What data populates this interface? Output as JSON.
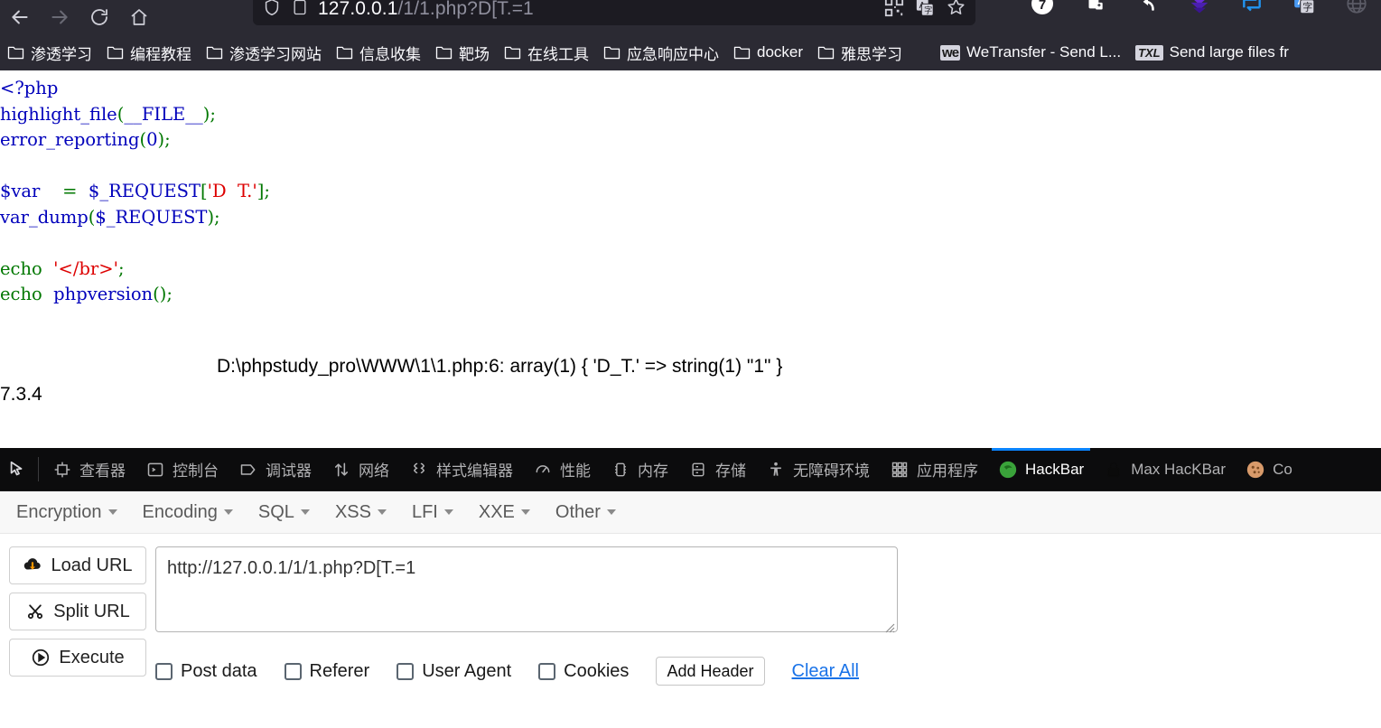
{
  "browser": {
    "nav": {
      "back_icon": "arrow-left-icon",
      "forward_icon": "arrow-right-icon",
      "reload_icon": "reload-icon",
      "home_icon": "home-icon"
    },
    "urlbar": {
      "shield_icon": "shield-icon",
      "page_icon": "page-icon",
      "url_host": "127.0.0.1",
      "url_path": "/1/1.php?D[T.=1",
      "url_full": "127.0.0.1/1/1.php?D[T.=1",
      "qr_icon": "qr-code-icon",
      "translate_icon": "translate-icon",
      "bookmark_icon": "star-icon"
    },
    "extensions": [
      {
        "name": "badge-seven-icon",
        "label": "7"
      },
      {
        "name": "cut-tool-icon",
        "label": ""
      },
      {
        "name": "undo-arrow-icon",
        "label": ""
      },
      {
        "name": "download-chevrons-icon",
        "label": ""
      },
      {
        "name": "swap-arrows-icon",
        "label": ""
      },
      {
        "name": "translate-ext-icon",
        "label": ""
      },
      {
        "name": "globe-icon",
        "label": ""
      }
    ],
    "bookmarks": [
      {
        "label": "渗透学习",
        "icon": "folder-icon"
      },
      {
        "label": "编程教程",
        "icon": "folder-icon"
      },
      {
        "label": "渗透学习网站",
        "icon": "folder-icon"
      },
      {
        "label": "信息收集",
        "icon": "folder-icon"
      },
      {
        "label": "靶场",
        "icon": "folder-icon"
      },
      {
        "label": "在线工具",
        "icon": "folder-icon"
      },
      {
        "label": "应急响应中心",
        "icon": "folder-icon"
      },
      {
        "label": "docker",
        "icon": "folder-icon"
      },
      {
        "label": "雅思学习",
        "icon": "folder-icon"
      },
      {
        "label": "WeTransfer - Send L...",
        "icon": "wetransfer-icon"
      },
      {
        "label": "Send large files fr",
        "icon": "txl-icon"
      }
    ]
  },
  "page": {
    "code_lines": [
      {
        "tokens": [
          {
            "t": "<?php",
            "c": "key"
          }
        ]
      },
      {
        "tokens": [
          {
            "t": "highlight_file",
            "c": "key"
          },
          {
            "t": "(",
            "c": "op"
          },
          {
            "t": "__FILE__",
            "c": "key"
          },
          {
            "t": ")",
            "c": "op"
          },
          {
            "t": ";",
            "c": "op"
          }
        ]
      },
      {
        "tokens": [
          {
            "t": "error_reporting",
            "c": "key"
          },
          {
            "t": "(",
            "c": "op"
          },
          {
            "t": "0",
            "c": "key"
          },
          {
            "t": ")",
            "c": "op"
          },
          {
            "t": ";",
            "c": "op"
          }
        ]
      },
      {
        "tokens": []
      },
      {
        "tokens": [
          {
            "t": "$var",
            "c": "key"
          },
          {
            "t": "    =  ",
            "c": "op"
          },
          {
            "t": "$_REQUEST",
            "c": "key"
          },
          {
            "t": "[",
            "c": "op"
          },
          {
            "t": "'D  T.'",
            "c": "str"
          },
          {
            "t": "]",
            "c": "op"
          },
          {
            "t": ";",
            "c": "op"
          }
        ]
      },
      {
        "tokens": [
          {
            "t": "var_dump",
            "c": "key"
          },
          {
            "t": "(",
            "c": "op"
          },
          {
            "t": "$_REQUEST",
            "c": "key"
          },
          {
            "t": ")",
            "c": "op"
          },
          {
            "t": ";",
            "c": "op"
          }
        ]
      },
      {
        "tokens": []
      },
      {
        "tokens": [
          {
            "t": "echo",
            "c": "op"
          },
          {
            "t": "  ",
            "c": "op"
          },
          {
            "t": "'</br>'",
            "c": "str"
          },
          {
            "t": ";",
            "c": "op"
          }
        ]
      },
      {
        "tokens": [
          {
            "t": "echo",
            "c": "op"
          },
          {
            "t": "  ",
            "c": "op"
          },
          {
            "t": "phpversion",
            "c": "key"
          },
          {
            "t": "()",
            "c": "op"
          },
          {
            "t": ";",
            "c": "op"
          }
        ]
      }
    ],
    "var_dump_output": "D:\\phpstudy_pro\\WWW\\1\\1.php:6: array(1) { 'D_T.' => string(1) \"1\" }",
    "php_version": "7.3.4"
  },
  "devtools": {
    "picker_icon": "element-picker-icon",
    "tabs": [
      {
        "label": "查看器",
        "icon": "inspector-icon",
        "active": false
      },
      {
        "label": "控制台",
        "icon": "console-icon",
        "active": false
      },
      {
        "label": "调试器",
        "icon": "debugger-icon",
        "active": false
      },
      {
        "label": "网络",
        "icon": "network-icon",
        "active": false
      },
      {
        "label": "样式编辑器",
        "icon": "style-editor-icon",
        "active": false
      },
      {
        "label": "性能",
        "icon": "performance-icon",
        "active": false
      },
      {
        "label": "内存",
        "icon": "memory-icon",
        "active": false
      },
      {
        "label": "存储",
        "icon": "storage-icon",
        "active": false
      },
      {
        "label": "无障碍环境",
        "icon": "accessibility-icon",
        "active": false
      },
      {
        "label": "应用程序",
        "icon": "application-icon",
        "active": false
      },
      {
        "label": "HackBar",
        "icon": "hackbar-icon",
        "active": true
      },
      {
        "label": "Max HacKBar",
        "icon": "lock-icon",
        "active": false
      },
      {
        "label": "Co",
        "icon": "cookie-icon",
        "active": false
      }
    ],
    "active_tab_color": "#0a84ff"
  },
  "hackbar": {
    "menus": [
      {
        "label": "Encryption"
      },
      {
        "label": "Encoding"
      },
      {
        "label": "SQL"
      },
      {
        "label": "XSS"
      },
      {
        "label": "LFI"
      },
      {
        "label": "XXE"
      },
      {
        "label": "Other"
      }
    ],
    "buttons": [
      {
        "label": "Load URL",
        "icon": "cloud-download-icon"
      },
      {
        "label": "Split URL",
        "icon": "scissors-icon"
      },
      {
        "label": "Execute",
        "icon": "play-circle-icon"
      }
    ],
    "url_value": "http://127.0.0.1/1/1.php?D[T.=1",
    "url_placeholder": "",
    "checkboxes": [
      {
        "label": "Post data",
        "checked": false
      },
      {
        "label": "Referer",
        "checked": false
      },
      {
        "label": "User Agent",
        "checked": false
      },
      {
        "label": "Cookies",
        "checked": false
      }
    ],
    "add_header_label": "Add Header",
    "clear_all_label": "Clear All",
    "link_color": "#1a73e8"
  }
}
